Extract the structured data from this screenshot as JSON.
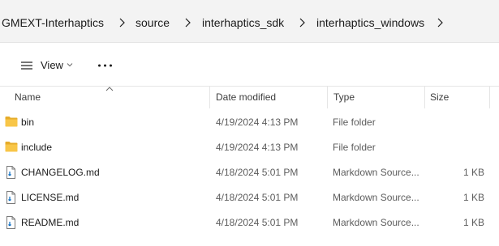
{
  "breadcrumb": [
    {
      "label": "GMEXT-Interhaptics"
    },
    {
      "label": "source"
    },
    {
      "label": "interhaptics_sdk"
    },
    {
      "label": "interhaptics_windows"
    }
  ],
  "toolbar": {
    "view_label": "View",
    "view_icon": "list-view-icon",
    "more_icon": "more-options-icon"
  },
  "columns": {
    "name": "Name",
    "date": "Date modified",
    "type": "Type",
    "size": "Size"
  },
  "files": [
    {
      "name": "bin",
      "date": "4/19/2024 4:13 PM",
      "type": "File folder",
      "size": "",
      "icon": "folder-icon"
    },
    {
      "name": "include",
      "date": "4/19/2024 4:13 PM",
      "type": "File folder",
      "size": "",
      "icon": "folder-icon"
    },
    {
      "name": "CHANGELOG.md",
      "date": "4/18/2024 5:01 PM",
      "type": "Markdown Source...",
      "size": "1 KB",
      "icon": "markdown-file-icon"
    },
    {
      "name": "LICENSE.md",
      "date": "4/18/2024 5:01 PM",
      "type": "Markdown Source...",
      "size": "1 KB",
      "icon": "markdown-file-icon"
    },
    {
      "name": "README.md",
      "date": "4/18/2024 5:01 PM",
      "type": "Markdown Source...",
      "size": "1 KB",
      "icon": "markdown-file-icon"
    }
  ],
  "colors": {
    "folder": "#f8c648",
    "folder_dark": "#e6ac2a",
    "accent": "#0067c0"
  }
}
